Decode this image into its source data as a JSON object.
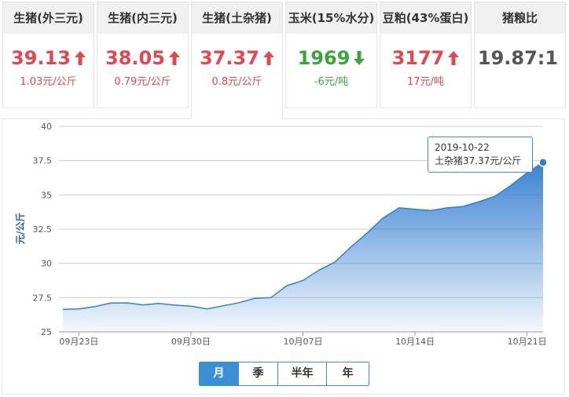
{
  "colors": {
    "up": "#e0474f",
    "down": "#3aa53a",
    "neutral": "#555555",
    "accent": "#3a8ed6"
  },
  "cards": [
    {
      "name": "生猪(外三元)",
      "value": "39.13",
      "direction": "up",
      "change": "1.03元/公斤"
    },
    {
      "name": "生猪(内三元)",
      "value": "38.05",
      "direction": "up",
      "change": "0.79元/公斤"
    },
    {
      "name": "生猪(土杂猪)",
      "value": "37.37",
      "direction": "up",
      "change": "0.8元/公斤"
    },
    {
      "name": "玉米(15%水分)",
      "value": "1969",
      "direction": "down",
      "change": "-6元/吨"
    },
    {
      "name": "豆粕(43%蛋白)",
      "value": "3177",
      "direction": "up",
      "change": "17元/吨"
    },
    {
      "name": "猪粮比",
      "value": "19.87:1",
      "direction": "none",
      "change": ""
    }
  ],
  "active_card": 2,
  "range_buttons": [
    "月",
    "季",
    "半年",
    "年"
  ],
  "active_range": 0,
  "tooltip": {
    "date": "2019-10-22",
    "text": "土杂猪37.37元/公斤"
  },
  "chart_data": {
    "type": "area",
    "title": "",
    "xlabel": "",
    "ylabel": "元/公斤",
    "ylim": [
      25,
      40
    ],
    "yticks": [
      "25",
      "27.5",
      "30",
      "32.5",
      "35",
      "37.5",
      "40"
    ],
    "xticks": [
      "09月23日",
      "09月30日",
      "10月07日",
      "10月14日",
      "10月21日"
    ],
    "grid": true,
    "series": [
      {
        "x": [
          "2019-09-22",
          "2019-09-23",
          "2019-09-24",
          "2019-09-25",
          "2019-09-26",
          "2019-09-27",
          "2019-09-28",
          "2019-09-29",
          "2019-09-30",
          "2019-10-01",
          "2019-10-02",
          "2019-10-03",
          "2019-10-04",
          "2019-10-05",
          "2019-10-06",
          "2019-10-07",
          "2019-10-08",
          "2019-10-09",
          "2019-10-10",
          "2019-10-11",
          "2019-10-12",
          "2019-10-13",
          "2019-10-14",
          "2019-10-15",
          "2019-10-16",
          "2019-10-17",
          "2019-10-18",
          "2019-10-19",
          "2019-10-20",
          "2019-10-21",
          "2019-10-22"
        ],
        "values": [
          26.65,
          26.68,
          26.85,
          27.1,
          27.12,
          26.97,
          27.08,
          26.95,
          26.88,
          26.68,
          26.9,
          27.13,
          27.45,
          27.5,
          28.38,
          28.75,
          29.5,
          30.1,
          31.2,
          32.2,
          33.3,
          34.05,
          33.95,
          33.85,
          34.05,
          34.15,
          34.5,
          34.9,
          35.7,
          36.6,
          37.37
        ]
      }
    ]
  }
}
